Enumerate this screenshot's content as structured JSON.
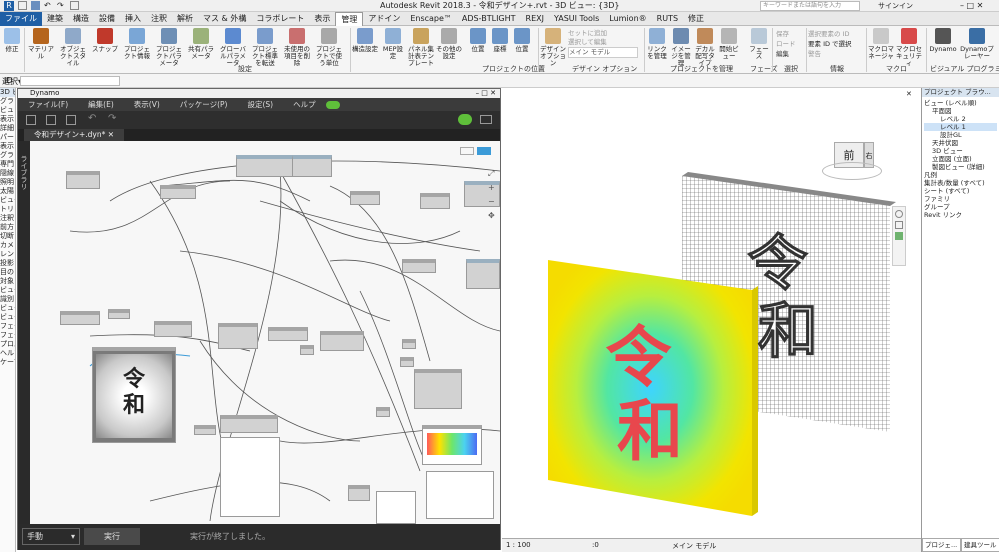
{
  "window": {
    "title": "Autodesk Revit 2018.3 -   令和デザイン+.rvt - 3D ビュー: {3D}",
    "search_placeholder": "キーワードまたは語句を入力",
    "signin": "サインイン"
  },
  "ribbon_tabs": [
    "ファイル",
    "建築",
    "構造",
    "設備",
    "挿入",
    "注釈",
    "解析",
    "マス & 外構",
    "コラボレート",
    "表示",
    "管理",
    "アドイン",
    "Enscape™",
    "ADS-BTLIGHT",
    "REXJ",
    "YASUI Tools",
    "Lumion®",
    "RUTS",
    "修正"
  ],
  "ribbon_selected_tab": "管理",
  "ribbon": {
    "modify": "修正",
    "select": "選択▾",
    "settings_items": [
      "マテリアル",
      "オブジェクトスタイル",
      "スナップ",
      "プロジェクト情報",
      "プロジェクトパラメータ",
      "共有パラメータ",
      "グローバルパラメータ",
      "プロジェクト標準を転送",
      "未使用の項目を削除",
      "プロジェクトで使う単位"
    ],
    "settings_group": "設定",
    "location_items": [
      "構造設定",
      "MEP設定",
      "パネル集計表テンプレート",
      "その他の設定"
    ],
    "location_items2": [
      "位置",
      "座標",
      "位置"
    ],
    "location_group": "プロジェクトの位置",
    "design_option": "デザインオプション",
    "design_option_small": [
      "セットに追加",
      "選択して編集"
    ],
    "design_option_combo": "メイン モデル",
    "design_option_group": "デザイン オプション",
    "manage_project_items": [
      "リンクを管理",
      "イメージを管理",
      "デカル配写タイプ",
      "開始ビュー"
    ],
    "manage_project_group": "プロジェクトを管理",
    "phases": "フェーズ",
    "phases_group": "フェーズ",
    "selection_small": [
      "保存",
      "ロード",
      "編集"
    ],
    "selection_group": "選択",
    "inquiry_small": [
      "選択要素の ID",
      "要素 ID で選択",
      "警告"
    ],
    "inquiry_group": "情報",
    "macro_items": [
      "マクロマネージャ",
      "マクロセキュリティ"
    ],
    "macro_group": "マクロ",
    "vp_items": [
      "Dynamo",
      "Dynamoプレーヤー"
    ],
    "vp_group": "ビジュアル プログラミング"
  },
  "options_bar": {
    "label": "ID"
  },
  "left_props": [
    "3D ビュー",
    "グラフィ",
    "ビュ",
    "表示",
    "詳細",
    "パー",
    "表示",
    "グラフ",
    "専門",
    "隠線",
    "照明",
    "太陽",
    "ビュー",
    "トリ",
    "注釈",
    "前方",
    "切断",
    "カメラ",
    "レン",
    "投影",
    "目の",
    "対象",
    "ビュー",
    "識別",
    "ビュー",
    "ビュー",
    "フェー",
    "フェー",
    "プロパ",
    "ヘルプ",
    "ケーブ"
  ],
  "dynamo": {
    "title": "Dynamo",
    "menu": [
      "ファイル(F)",
      "編集(E)",
      "表示(V)",
      "パッケージ(P)",
      "設定(S)",
      "ヘルプ"
    ],
    "tab": "令和デザイン+.dyn*",
    "library": "ライブラリ",
    "run_mode": "手動",
    "run_button": "実行",
    "status": "実行が終了しました。",
    "watch_image_text": "令\n和"
  },
  "revit_view": {
    "viewcube_face": "前",
    "viewcube_side": "右",
    "model_text": "令\n和"
  },
  "status_bar": {
    "scale": "1 : 100",
    "model": "メイン モデル",
    "count": ":0"
  },
  "browser": {
    "title": "プロジェクト ブラウ...",
    "items": [
      {
        "label": "ビュー (レベル順)",
        "indent": 0
      },
      {
        "label": "平面図",
        "indent": 1
      },
      {
        "label": "レベル 2",
        "indent": 2
      },
      {
        "label": "レベル 1",
        "indent": 2
      },
      {
        "label": "設計GL",
        "indent": 2
      },
      {
        "label": "天井伏図",
        "indent": 1
      },
      {
        "label": "3D ビュー",
        "indent": 1
      },
      {
        "label": "立面図 (立面)",
        "indent": 1
      },
      {
        "label": "製図ビュー (詳細)",
        "indent": 1
      },
      {
        "label": "凡例",
        "indent": 0
      },
      {
        "label": "集計表/数量 (すべて)",
        "indent": 0
      },
      {
        "label": "シート (すべて)",
        "indent": 0
      },
      {
        "label": "ファミリ",
        "indent": 0
      },
      {
        "label": "グループ",
        "indent": 0
      },
      {
        "label": "Revit リンク",
        "indent": 0
      }
    ],
    "footer_tabs": [
      "プロジェ...",
      "建具ツール"
    ]
  },
  "colors": {
    "accent": "#1f5fa5",
    "dynamo_dark": "#3b3b3b",
    "heat_yellow": "#f2e400",
    "glyph_red": "#e8474d"
  }
}
